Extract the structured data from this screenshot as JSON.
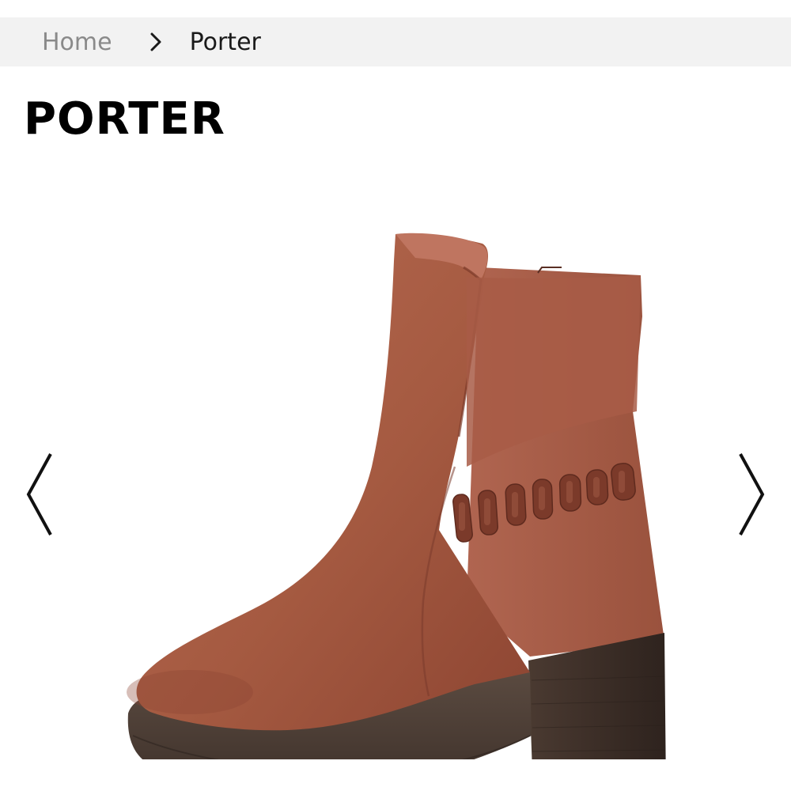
{
  "breadcrumb": {
    "items": [
      {
        "label": "Home"
      },
      {
        "label": "Porter"
      }
    ],
    "separator_icon": "chevron-right-icon"
  },
  "product": {
    "title": "PORTER",
    "image": {
      "subject": "brown leather ankle boot with woven strap detail and stacked block heel",
      "icon": "product-photo"
    }
  },
  "gallery": {
    "prev_icon": "chevron-left-icon",
    "next_icon": "chevron-right-icon"
  },
  "colors": {
    "breadcrumb_bg": "#f2f2f2",
    "breadcrumb_inactive": "#8a8a8a",
    "text": "#1a1a1a",
    "leather": "#a8583f",
    "leather_dark": "#7b3a2a",
    "heel": "#3e2f28"
  }
}
